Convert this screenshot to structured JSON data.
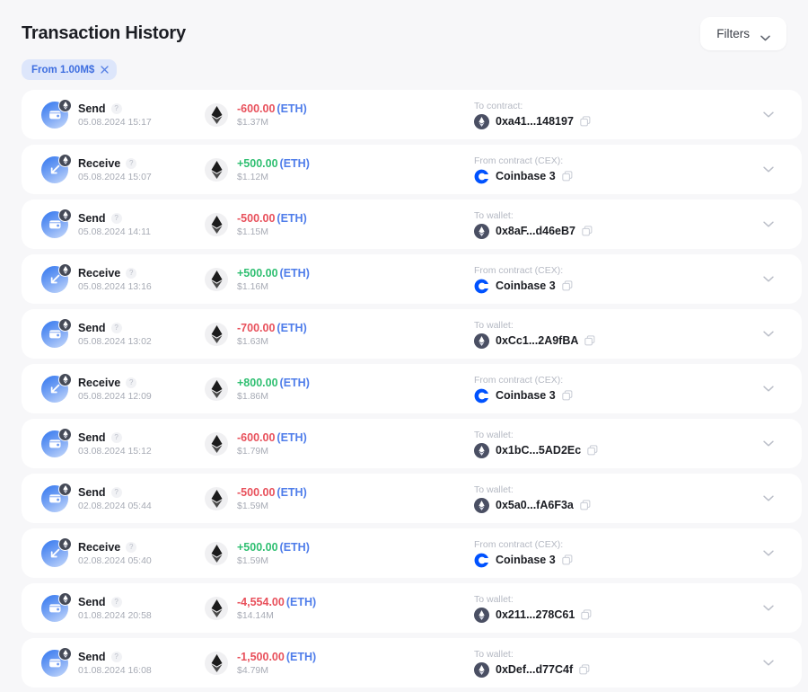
{
  "header": {
    "title": "Transaction History",
    "filters_button_label": "Filters"
  },
  "filter_chips": [
    {
      "label": "From 1.00M$"
    }
  ],
  "transactions": [
    {
      "type": "Send",
      "direction": "out",
      "datetime": "05.08.2024 15:17",
      "amount": "-600.00",
      "symbol": "(ETH)",
      "usd": "$1.37M",
      "dest_label": "To contract:",
      "dest_value": "0xa41...148197",
      "dest_icon": "eth-icon"
    },
    {
      "type": "Receive",
      "direction": "in",
      "datetime": "05.08.2024 15:07",
      "amount": "+500.00",
      "symbol": "(ETH)",
      "usd": "$1.12M",
      "dest_label": "From contract (CEX):",
      "dest_value": "Coinbase 3",
      "dest_icon": "coinbase-icon"
    },
    {
      "type": "Send",
      "direction": "out",
      "datetime": "05.08.2024 14:11",
      "amount": "-500.00",
      "symbol": "(ETH)",
      "usd": "$1.15M",
      "dest_label": "To wallet:",
      "dest_value": "0x8aF...d46eB7",
      "dest_icon": "eth-icon"
    },
    {
      "type": "Receive",
      "direction": "in",
      "datetime": "05.08.2024 13:16",
      "amount": "+500.00",
      "symbol": "(ETH)",
      "usd": "$1.16M",
      "dest_label": "From contract (CEX):",
      "dest_value": "Coinbase 3",
      "dest_icon": "coinbase-icon"
    },
    {
      "type": "Send",
      "direction": "out",
      "datetime": "05.08.2024 13:02",
      "amount": "-700.00",
      "symbol": "(ETH)",
      "usd": "$1.63M",
      "dest_label": "To wallet:",
      "dest_value": "0xCc1...2A9fBA",
      "dest_icon": "eth-icon"
    },
    {
      "type": "Receive",
      "direction": "in",
      "datetime": "05.08.2024 12:09",
      "amount": "+800.00",
      "symbol": "(ETH)",
      "usd": "$1.86M",
      "dest_label": "From contract (CEX):",
      "dest_value": "Coinbase 3",
      "dest_icon": "coinbase-icon"
    },
    {
      "type": "Send",
      "direction": "out",
      "datetime": "03.08.2024 15:12",
      "amount": "-600.00",
      "symbol": "(ETH)",
      "usd": "$1.79M",
      "dest_label": "To wallet:",
      "dest_value": "0x1bC...5AD2Ec",
      "dest_icon": "eth-icon"
    },
    {
      "type": "Send",
      "direction": "out",
      "datetime": "02.08.2024 05:44",
      "amount": "-500.00",
      "symbol": "(ETH)",
      "usd": "$1.59M",
      "dest_label": "To wallet:",
      "dest_value": "0x5a0...fA6F3a",
      "dest_icon": "eth-icon"
    },
    {
      "type": "Receive",
      "direction": "in",
      "datetime": "02.08.2024 05:40",
      "amount": "+500.00",
      "symbol": "(ETH)",
      "usd": "$1.59M",
      "dest_label": "From contract (CEX):",
      "dest_value": "Coinbase 3",
      "dest_icon": "coinbase-icon"
    },
    {
      "type": "Send",
      "direction": "out",
      "datetime": "01.08.2024 20:58",
      "amount": "-4,554.00",
      "symbol": "(ETH)",
      "usd": "$14.14M",
      "dest_label": "To wallet:",
      "dest_value": "0x211...278C61",
      "dest_icon": "eth-icon"
    },
    {
      "type": "Send",
      "direction": "out",
      "datetime": "01.08.2024 16:08",
      "amount": "-1,500.00",
      "symbol": "(ETH)",
      "usd": "$4.79M",
      "dest_label": "To wallet:",
      "dest_value": "0xDef...d77C4f",
      "dest_icon": "eth-icon"
    }
  ],
  "icons": {
    "help_glyph": "?",
    "chip_close": "close-icon",
    "expand": "chevron-down-icon",
    "copy": "copy-icon"
  },
  "colors": {
    "page_bg": "#f7f7f9",
    "card_bg": "#ffffff",
    "negative": "#e8505b",
    "positive": "#2fbf71",
    "symbol": "#4f7dea",
    "chip_bg": "#dde6fb",
    "chip_text": "#3f6fe0",
    "muted": "#a7abb5",
    "coinbase": "#0052ff"
  }
}
